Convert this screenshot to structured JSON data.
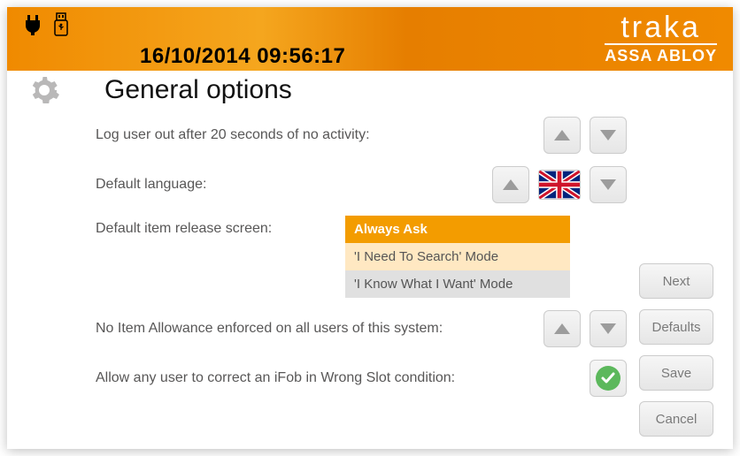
{
  "header": {
    "datetime": "16/10/2014 09:56:17",
    "brand_main": "traka",
    "brand_sub": "ASSA ABLOY"
  },
  "title": "General options",
  "labels": {
    "logout": "Log user out after 20 seconds of no activity:",
    "language": "Default language:",
    "release": "Default item release screen:",
    "allowance": "No Item Allowance enforced on all users of this system:",
    "correct_slot": "Allow any user to correct an iFob in Wrong Slot condition:"
  },
  "release_options": {
    "selected": "Always Ask",
    "opt1": "'I Need To Search' Mode",
    "opt2": "'I Know What I Want' Mode"
  },
  "buttons": {
    "next": "Next",
    "defaults": "Defaults",
    "save": "Save",
    "cancel": "Cancel"
  },
  "flags": {
    "language": "uk-flag"
  },
  "toggles": {
    "correct_slot_enabled": true
  }
}
